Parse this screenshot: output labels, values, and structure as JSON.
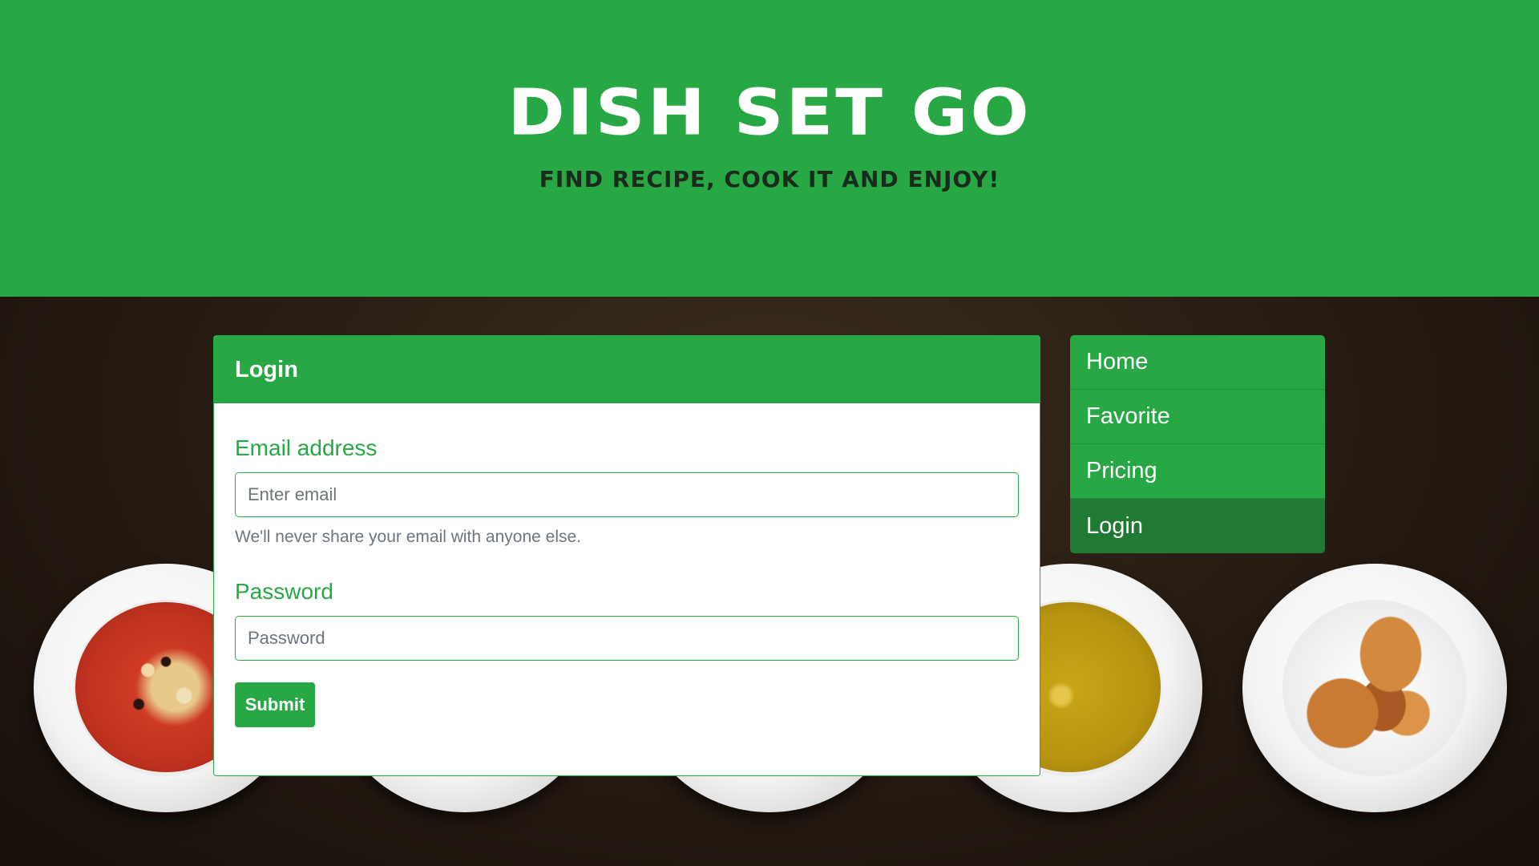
{
  "header": {
    "title": "DISH SET GO",
    "tagline": "FIND RECIPE, COOK IT AND ENJOY!"
  },
  "login_form": {
    "card_title": "Login",
    "email_label": "Email address",
    "email_placeholder": "Enter email",
    "email_value": "",
    "email_help": "We'll never share your email with anyone else.",
    "password_label": "Password",
    "password_placeholder": "Password",
    "password_value": "",
    "submit_label": "Submit"
  },
  "nav": {
    "items": [
      {
        "label": "Home"
      },
      {
        "label": "Favorite"
      },
      {
        "label": "Pricing"
      },
      {
        "label": "Login"
      }
    ],
    "active": "Login"
  },
  "colors": {
    "brand_green": "#28a745",
    "active_nav": "#217a34",
    "background": "#241a12"
  }
}
